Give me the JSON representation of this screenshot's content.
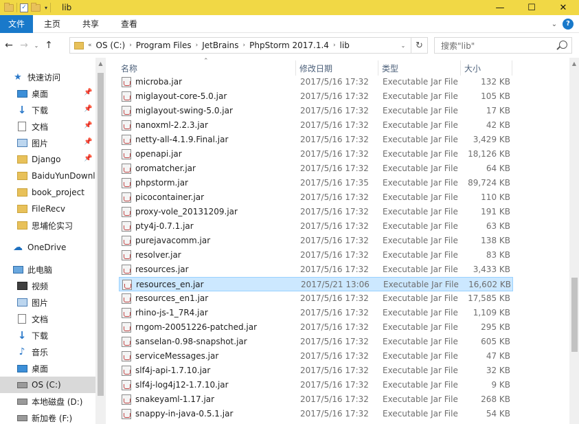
{
  "window": {
    "title": "lib",
    "controls": {
      "minimize": "—",
      "maximize": "☐",
      "close": "✕"
    }
  },
  "quick_access_toolbar": {
    "check_glyph": "✓",
    "dropdown_glyph": "▾"
  },
  "ribbon": {
    "tabs": [
      "文件",
      "主页",
      "共享",
      "查看"
    ],
    "expand_glyph": "⌄",
    "help_glyph": "?"
  },
  "nav": {
    "back": "←",
    "forward": "→",
    "recent": "⌄",
    "up": "↑"
  },
  "address": {
    "overflow": "«",
    "separator": "›",
    "crumbs": [
      "OS (C:)",
      "Program Files",
      "JetBrains",
      "PhpStorm 2017.1.4",
      "lib"
    ],
    "dropdown_glyph": "⌄",
    "refresh_glyph": "↻"
  },
  "search": {
    "placeholder": "搜索\"lib\""
  },
  "sidebar": {
    "scroll_up_glyph": "▲",
    "pin_glyph": "📌",
    "items": [
      {
        "label": "快速访问",
        "icon": "star-icon"
      },
      {
        "label": "桌面",
        "icon": "desktop-icon",
        "pinned": true
      },
      {
        "label": "下载",
        "icon": "download-icon",
        "pinned": true
      },
      {
        "label": "文档",
        "icon": "documents-icon",
        "pinned": true
      },
      {
        "label": "图片",
        "icon": "pictures-icon",
        "pinned": true
      },
      {
        "label": "Django",
        "icon": "folder-icon",
        "pinned": true
      },
      {
        "label": "BaiduYunDownl",
        "icon": "folder-icon"
      },
      {
        "label": "book_project",
        "icon": "folder-icon"
      },
      {
        "label": "FileRecv",
        "icon": "folder-icon"
      },
      {
        "label": "思埔伦实习",
        "icon": "folder-icon"
      },
      {
        "label": "OneDrive",
        "icon": "onedrive-icon"
      },
      {
        "label": "此电脑",
        "icon": "this-pc-icon"
      },
      {
        "label": "视频",
        "icon": "videos-icon"
      },
      {
        "label": "图片",
        "icon": "pictures-icon"
      },
      {
        "label": "文档",
        "icon": "documents-icon"
      },
      {
        "label": "下载",
        "icon": "download-icon"
      },
      {
        "label": "音乐",
        "icon": "music-icon"
      },
      {
        "label": "桌面",
        "icon": "desktop-icon"
      },
      {
        "label": "OS (C:)",
        "icon": "drive-icon",
        "selected": true
      },
      {
        "label": "本地磁盘 (D:)",
        "icon": "drive-icon"
      },
      {
        "label": "新加卷 (F:)",
        "icon": "drive-icon"
      }
    ]
  },
  "columns": {
    "sort_glyph": "⌃",
    "name": "名称",
    "date": "修改日期",
    "type": "类型",
    "size": "大小"
  },
  "files": [
    {
      "name": "microba.jar",
      "date": "2017/5/16 17:32",
      "type": "Executable Jar File",
      "size": "132 KB"
    },
    {
      "name": "miglayout-core-5.0.jar",
      "date": "2017/5/16 17:32",
      "type": "Executable Jar File",
      "size": "105 KB"
    },
    {
      "name": "miglayout-swing-5.0.jar",
      "date": "2017/5/16 17:32",
      "type": "Executable Jar File",
      "size": "17 KB"
    },
    {
      "name": "nanoxml-2.2.3.jar",
      "date": "2017/5/16 17:32",
      "type": "Executable Jar File",
      "size": "42 KB"
    },
    {
      "name": "netty-all-4.1.9.Final.jar",
      "date": "2017/5/16 17:32",
      "type": "Executable Jar File",
      "size": "3,429 KB"
    },
    {
      "name": "openapi.jar",
      "date": "2017/5/16 17:32",
      "type": "Executable Jar File",
      "size": "18,126 KB"
    },
    {
      "name": "oromatcher.jar",
      "date": "2017/5/16 17:32",
      "type": "Executable Jar File",
      "size": "64 KB"
    },
    {
      "name": "phpstorm.jar",
      "date": "2017/5/16 17:35",
      "type": "Executable Jar File",
      "size": "89,724 KB"
    },
    {
      "name": "picocontainer.jar",
      "date": "2017/5/16 17:32",
      "type": "Executable Jar File",
      "size": "110 KB"
    },
    {
      "name": "proxy-vole_20131209.jar",
      "date": "2017/5/16 17:32",
      "type": "Executable Jar File",
      "size": "191 KB"
    },
    {
      "name": "pty4j-0.7.1.jar",
      "date": "2017/5/16 17:32",
      "type": "Executable Jar File",
      "size": "63 KB"
    },
    {
      "name": "purejavacomm.jar",
      "date": "2017/5/16 17:32",
      "type": "Executable Jar File",
      "size": "138 KB"
    },
    {
      "name": "resolver.jar",
      "date": "2017/5/16 17:32",
      "type": "Executable Jar File",
      "size": "83 KB"
    },
    {
      "name": "resources.jar",
      "date": "2017/5/16 17:32",
      "type": "Executable Jar File",
      "size": "3,433 KB"
    },
    {
      "name": "resources_en.jar",
      "date": "2017/5/21 13:06",
      "type": "Executable Jar File",
      "size": "16,602 KB",
      "selected": true
    },
    {
      "name": "resources_en1.jar",
      "date": "2017/5/16 17:32",
      "type": "Executable Jar File",
      "size": "17,585 KB"
    },
    {
      "name": "rhino-js-1_7R4.jar",
      "date": "2017/5/16 17:32",
      "type": "Executable Jar File",
      "size": "1,109 KB"
    },
    {
      "name": "rngom-20051226-patched.jar",
      "date": "2017/5/16 17:32",
      "type": "Executable Jar File",
      "size": "295 KB"
    },
    {
      "name": "sanselan-0.98-snapshot.jar",
      "date": "2017/5/16 17:32",
      "type": "Executable Jar File",
      "size": "605 KB"
    },
    {
      "name": "serviceMessages.jar",
      "date": "2017/5/16 17:32",
      "type": "Executable Jar File",
      "size": "47 KB"
    },
    {
      "name": "slf4j-api-1.7.10.jar",
      "date": "2017/5/16 17:32",
      "type": "Executable Jar File",
      "size": "32 KB"
    },
    {
      "name": "slf4j-log4j12-1.7.10.jar",
      "date": "2017/5/16 17:32",
      "type": "Executable Jar File",
      "size": "9 KB"
    },
    {
      "name": "snakeyaml-1.17.jar",
      "date": "2017/5/16 17:32",
      "type": "Executable Jar File",
      "size": "268 KB"
    },
    {
      "name": "snappy-in-java-0.5.1.jar",
      "date": "2017/5/16 17:32",
      "type": "Executable Jar File",
      "size": "54 KB"
    }
  ],
  "scrollbar": {
    "up_glyph": "▲"
  }
}
